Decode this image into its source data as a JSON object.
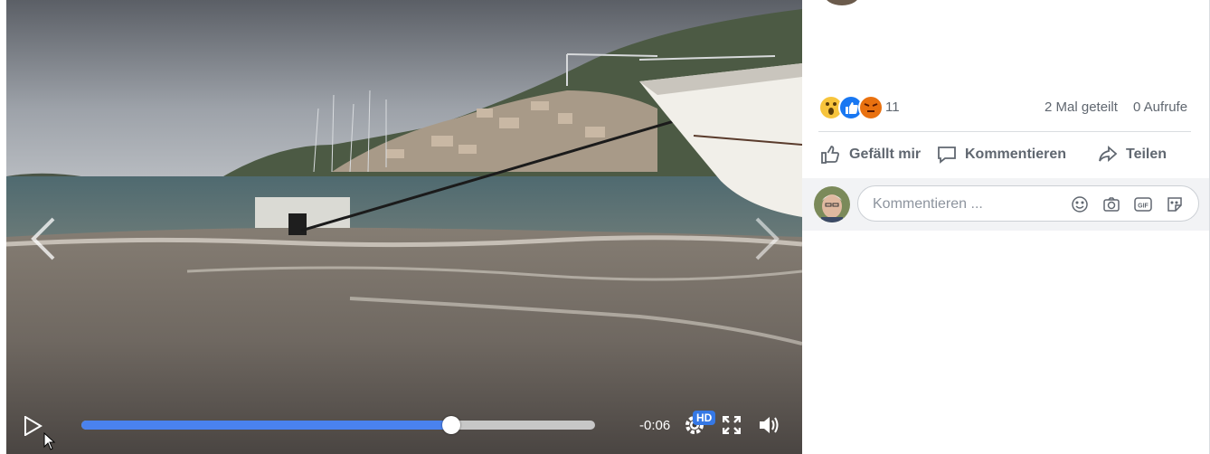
{
  "video": {
    "time_remaining": "-0:06",
    "progress_fraction": 0.72,
    "hd_label": "HD"
  },
  "post": {
    "reaction_count": "11",
    "shares": "2 Mal geteilt",
    "views": "0 Aufrufe",
    "actions": {
      "like": "Gefällt mir",
      "comment": "Kommentieren",
      "share": "Teilen"
    },
    "comment_placeholder": "Kommentieren ..."
  },
  "colors": {
    "accent": "#4a82ee",
    "hd_badge": "#3578e5",
    "text_muted": "#606770"
  }
}
